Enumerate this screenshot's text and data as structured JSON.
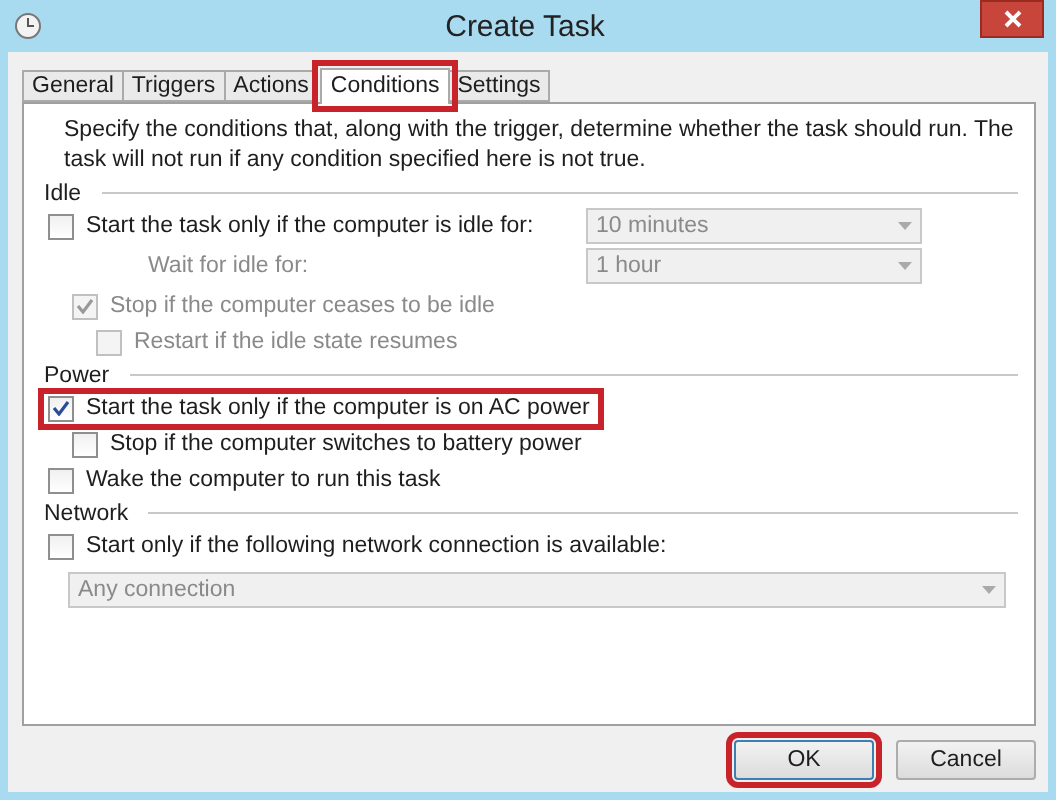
{
  "window": {
    "title": "Create Task"
  },
  "tabs": [
    {
      "label": "General",
      "selected": false,
      "highlighted": false
    },
    {
      "label": "Triggers",
      "selected": false,
      "highlighted": false
    },
    {
      "label": "Actions",
      "selected": false,
      "highlighted": false
    },
    {
      "label": "Conditions",
      "selected": true,
      "highlighted": true
    },
    {
      "label": "Settings",
      "selected": false,
      "highlighted": false
    }
  ],
  "description": "Specify the conditions that, along with the trigger, determine whether the task should run.  The task will not run  if any condition specified here is not true.",
  "sections": [
    {
      "title": "Idle",
      "rows": [
        {
          "kind": "checkbox",
          "label": "Start the task only if the computer is idle for:",
          "checked": false,
          "disabled": false,
          "highlighted": false,
          "dropdown": {
            "value": "10 minutes",
            "disabled": true
          },
          "children": [
            {
              "kind": "label",
              "label": "Wait for idle for:",
              "disabled": true,
              "dropdown": {
                "value": "1 hour",
                "disabled": true
              }
            },
            {
              "kind": "checkbox",
              "label": "Stop if the computer ceases to be idle",
              "checked": true,
              "disabled": true,
              "highlighted": false,
              "children": [
                {
                  "kind": "checkbox",
                  "label": "Restart if the idle state resumes",
                  "checked": false,
                  "disabled": true,
                  "highlighted": false
                }
              ]
            }
          ]
        }
      ]
    },
    {
      "title": "Power",
      "rows": [
        {
          "kind": "checkbox",
          "label": "Start the task only if the computer is on AC power",
          "checked": true,
          "disabled": false,
          "highlighted": true,
          "children": [
            {
              "kind": "checkbox",
              "label": "Stop if the computer switches to battery power",
              "checked": false,
              "disabled": false,
              "highlighted": false
            }
          ]
        },
        {
          "kind": "checkbox",
          "label": "Wake the computer to run this task",
          "checked": false,
          "disabled": false,
          "highlighted": false
        }
      ]
    },
    {
      "title": "Network",
      "rows": [
        {
          "kind": "checkbox",
          "label": "Start only if the following network connection is available:",
          "checked": false,
          "disabled": false,
          "highlighted": false,
          "children": [
            {
              "kind": "dropdown",
              "value": "Any connection",
              "disabled": true
            }
          ]
        }
      ]
    }
  ],
  "buttons": [
    {
      "label": "OK",
      "highlighted": true
    },
    {
      "label": "Cancel",
      "highlighted": false
    }
  ]
}
